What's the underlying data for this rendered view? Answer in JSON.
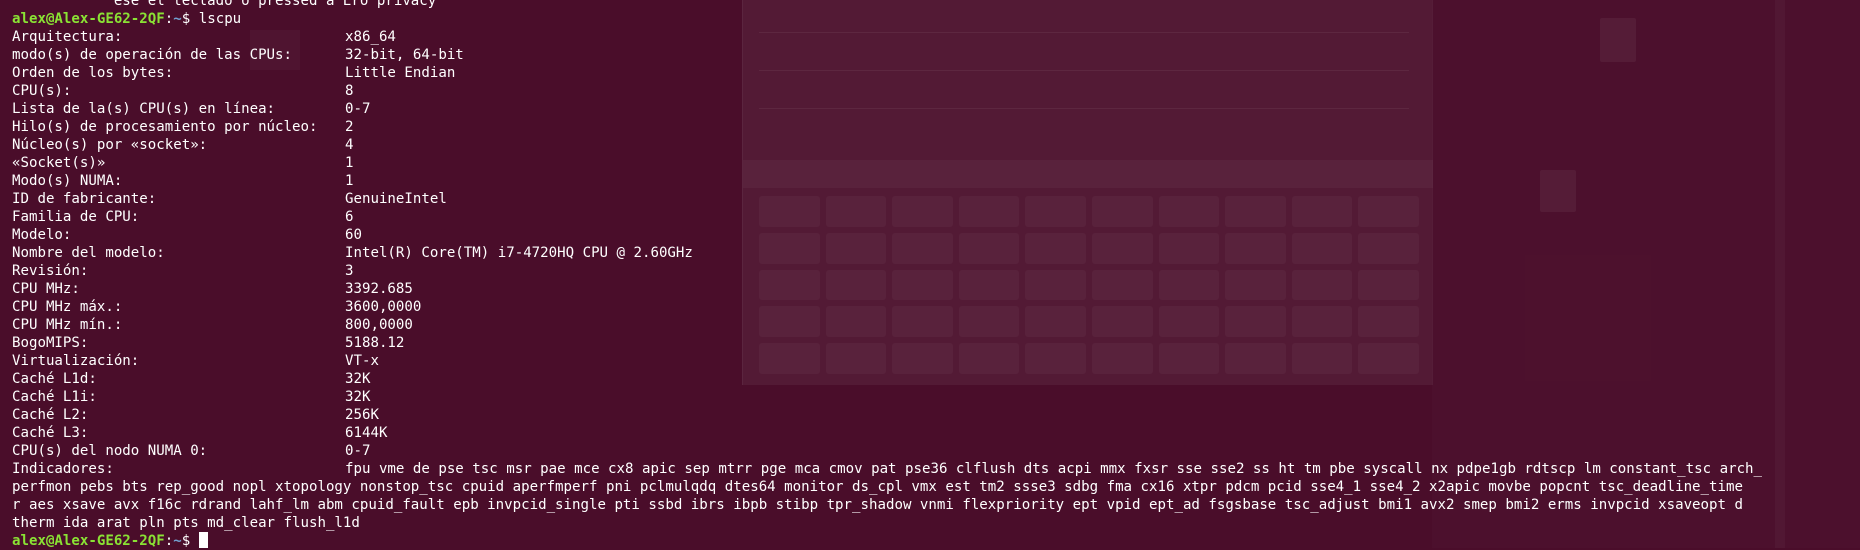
{
  "terminal": {
    "prompt_user": "alex@Alex-GE62-2QF",
    "prompt_path": "~",
    "prompt_symbol": "$",
    "command": "lscpu",
    "top_cut_text": "            ese el teclado o pressed a Ero privacy",
    "rows": [
      {
        "key": "Arquitectura:",
        "value": "x86_64"
      },
      {
        "key": "modo(s) de operación de las CPUs:",
        "value": "32-bit, 64-bit"
      },
      {
        "key": "Orden de los bytes:",
        "value": "Little Endian"
      },
      {
        "key": "CPU(s):",
        "value": "8"
      },
      {
        "key": "Lista de la(s) CPU(s) en línea:",
        "value": "0-7"
      },
      {
        "key": "Hilo(s) de procesamiento por núcleo:",
        "value": "2"
      },
      {
        "key": "Núcleo(s) por «socket»:",
        "value": "4"
      },
      {
        "key": "«Socket(s)»",
        "value": "1"
      },
      {
        "key": "Modo(s) NUMA:",
        "value": "1"
      },
      {
        "key": "ID de fabricante:",
        "value": "GenuineIntel"
      },
      {
        "key": "Familia de CPU:",
        "value": "6"
      },
      {
        "key": "Modelo:",
        "value": "60"
      },
      {
        "key": "Nombre del modelo:",
        "value": "Intel(R) Core(TM) i7-4720HQ CPU @ 2.60GHz"
      },
      {
        "key": "Revisión:",
        "value": "3"
      },
      {
        "key": "CPU MHz:",
        "value": "3392.685"
      },
      {
        "key": "CPU MHz máx.:",
        "value": "3600,0000"
      },
      {
        "key": "CPU MHz mín.:",
        "value": "800,0000"
      },
      {
        "key": "BogoMIPS:",
        "value": "5188.12"
      },
      {
        "key": "Virtualización:",
        "value": "VT-x"
      },
      {
        "key": "Caché L1d:",
        "value": "32K"
      },
      {
        "key": "Caché L1i:",
        "value": "32K"
      },
      {
        "key": "Caché L2:",
        "value": "256K"
      },
      {
        "key": "Caché L3:",
        "value": "6144K"
      },
      {
        "key": "CPU(s) del nodo NUMA 0:",
        "value": "0-7"
      }
    ],
    "flags_key": "Indicadores:",
    "flags_lines": [
      "fpu vme de pse tsc msr pae mce cx8 apic sep mtrr pge mca cmov pat pse36 clflush dts acpi mmx fxsr sse sse2 ss ht tm pbe syscall nx pdpe1gb rdtscp lm constant_tsc arch_",
      "perfmon pebs bts rep_good nopl xtopology nonstop_tsc cpuid aperfmperf pni pclmulqdq dtes64 monitor ds_cpl vmx est tm2 ssse3 sdbg fma cx16 xtpr pdcm pcid sse4_1 sse4_2 x2apic movbe popcnt tsc_deadline_time",
      "r aes xsave avx f16c rdrand lahf_lm abm cpuid_fault epb invpcid_single pti ssbd ibrs ibpb stibp tpr_shadow vnmi flexpriority ept vpid ept_ad fsgsbase tsc_adjust bmi1 avx2 smep bmi2 erms invpcid xsaveopt d",
      "therm ida arat pln pts md_clear flush_l1d"
    ],
    "colors": {
      "background": "#4a0d2a",
      "text": "#ffffff",
      "prompt_user": "#8ae234",
      "prompt_path": "#729fcf"
    }
  }
}
